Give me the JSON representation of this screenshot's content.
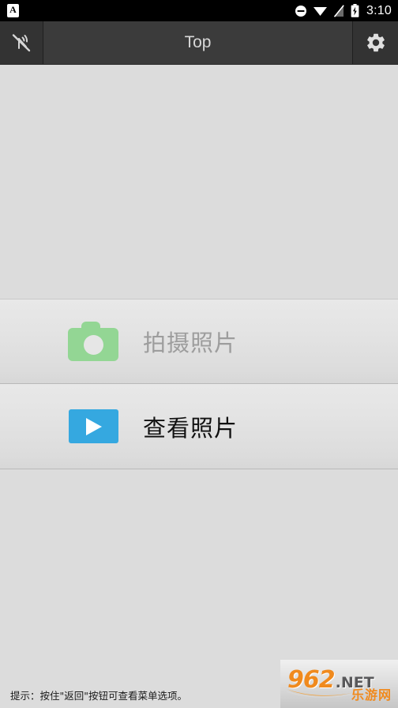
{
  "status_bar": {
    "notification_icon": "letter-a-notification-icon",
    "notification_letter": "A",
    "icons": [
      "do-not-disturb-icon",
      "wifi-icon",
      "cellular-signal-off-icon",
      "battery-charging-icon"
    ],
    "time": "3:10",
    "background_color": "#000000"
  },
  "action_bar": {
    "left_icon": "wireless-off-icon",
    "title": "Top",
    "right_icon": "settings-gear-icon",
    "background_color": "#373737",
    "title_color": "#d8d8d8"
  },
  "main": {
    "background_color": "#dcdcdc",
    "items": [
      {
        "icon": "camera-icon",
        "icon_color": "#93d694",
        "label": "拍摄照片",
        "label_color": "#9d9d9d",
        "enabled": false
      },
      {
        "icon": "play-video-icon",
        "icon_color": "#35a8e0",
        "label": "查看照片",
        "label_color": "#111111",
        "enabled": true
      }
    ]
  },
  "footer": {
    "hint": "提示：按住\"返回\"按钮可查看菜单选项。",
    "hint_color": "#1b1b1b"
  },
  "watermark": {
    "number": "962",
    "tld": ".NET",
    "chinese": "乐游网",
    "number_color": "#f08a1e",
    "tld_color": "#58585a"
  }
}
